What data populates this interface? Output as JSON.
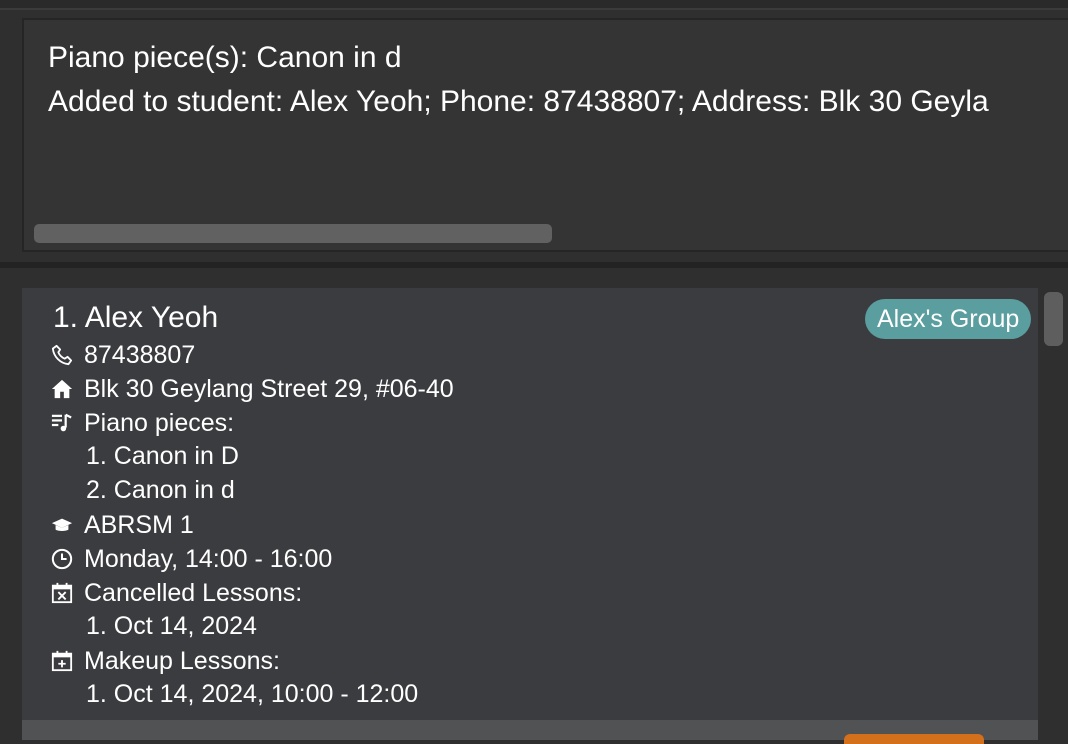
{
  "result": {
    "line1": "Piano piece(s): Canon in d",
    "line2": "Added to student: Alex Yeoh; Phone: 87438807; Address: Blk 30 Geyla"
  },
  "student": {
    "index_name": "1. Alex Yeoh",
    "group_tag": "Alex's Group",
    "phone": "87438807",
    "address": "Blk 30 Geylang Street 29, #06-40",
    "pieces_label": "Piano pieces:",
    "pieces": [
      "1. Canon in D",
      "2. Canon in d"
    ],
    "grade": "ABRSM 1",
    "schedule": "Monday, 14:00 - 16:00",
    "cancelled_label": "Cancelled Lessons:",
    "cancelled": [
      "1. Oct 14, 2024"
    ],
    "makeup_label": "Makeup Lessons:",
    "makeup": [
      "1. Oct 14, 2024, 10:00 - 12:00"
    ]
  },
  "icons": {
    "phone": "phone-icon",
    "address": "home-icon",
    "pieces": "music-list-icon",
    "grade": "graduation-cap-icon",
    "schedule": "clock-icon",
    "cancelled": "calendar-x-icon",
    "makeup": "calendar-plus-icon"
  },
  "colors": {
    "tag": "#5a9e9f",
    "background": "#2f2f30",
    "card": "#3b3c3f"
  }
}
